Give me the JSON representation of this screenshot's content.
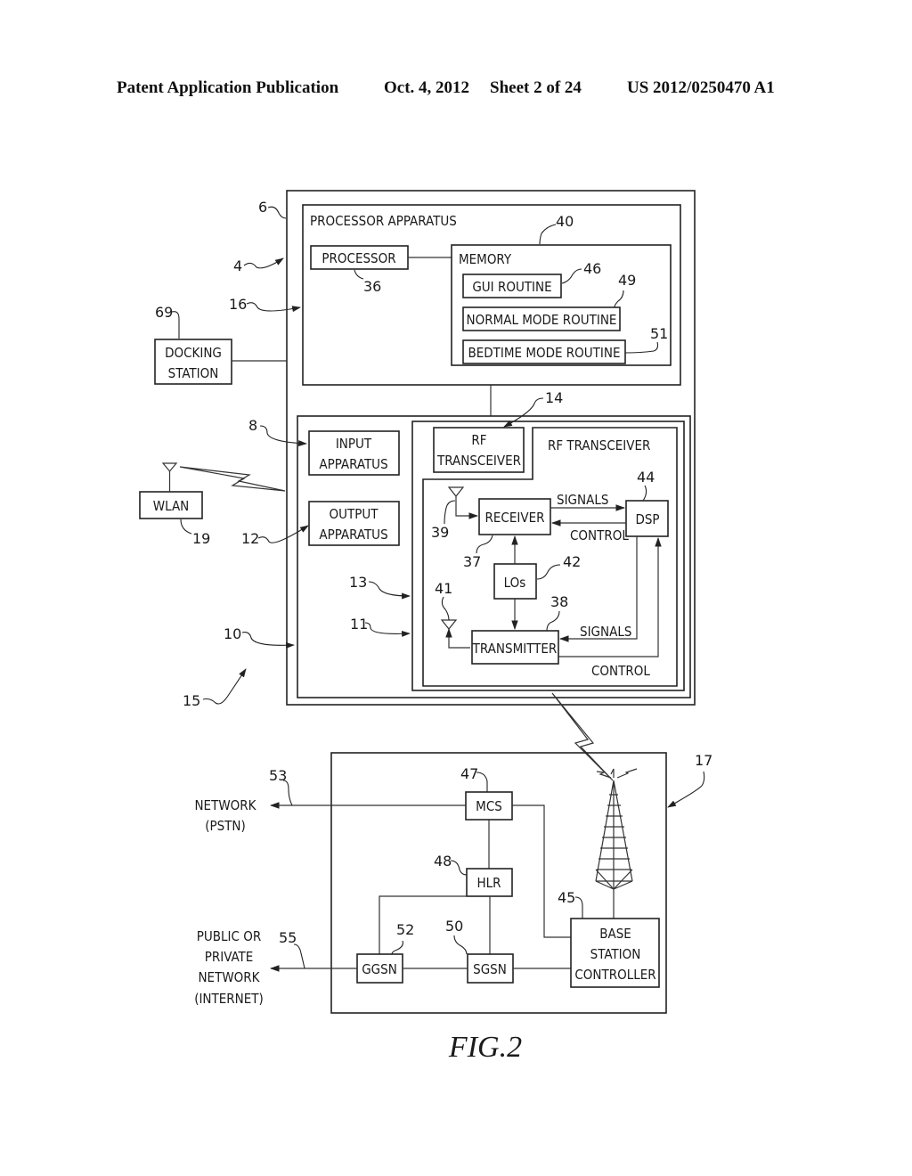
{
  "header": {
    "publication": "Patent Application Publication",
    "date": "Oct. 4, 2012",
    "sheet": "Sheet 2 of 24",
    "number": "US 2012/0250470 A1"
  },
  "figure": {
    "caption": "FIG.2",
    "device": {
      "ref_outer": "6",
      "ref_device": "4",
      "ref_system": "15",
      "processor_apparatus": {
        "title": "PROCESSOR APPARATUS",
        "ref": "16",
        "processor": {
          "label": "PROCESSOR",
          "ref": "36"
        },
        "memory": {
          "label": "MEMORY",
          "ref": "40",
          "routines": [
            {
              "label": "GUI ROUTINE",
              "ref": "46"
            },
            {
              "label": "NORMAL MODE ROUTINE",
              "ref": "49"
            },
            {
              "label": "BEDTIME MODE ROUTINE",
              "ref": "51"
            }
          ]
        }
      },
      "io_block_ref": "10",
      "input_apparatus": {
        "line1": "INPUT",
        "line2": "APPARATUS",
        "ref": "8"
      },
      "output_apparatus": {
        "line1": "OUTPUT",
        "line2": "APPARATUS",
        "ref": "12"
      },
      "rf": {
        "ref_outer": "13",
        "ref_inner": "11",
        "ref_tab": "14",
        "tab_line1": "RF",
        "tab_line2": "TRANSCEIVER",
        "title": "RF TRANSCEIVER",
        "receiver": {
          "label": "RECEIVER",
          "ref": "37"
        },
        "transmitter": {
          "label": "TRANSMITTER",
          "ref": "38"
        },
        "los": {
          "label": "LOs",
          "ref": "42"
        },
        "dsp": {
          "label": "DSP",
          "ref": "44"
        },
        "rx_antenna_ref": "39",
        "tx_antenna_ref": "41",
        "signals_label": "SIGNALS",
        "control_label": "CONTROL"
      }
    },
    "docking_station": {
      "line1": "DOCKING",
      "line2": "STATION",
      "ref": "69"
    },
    "wlan": {
      "label": "WLAN",
      "ref": "19"
    },
    "network": {
      "ref": "17",
      "mcs": {
        "label": "MCS",
        "ref": "47"
      },
      "hlr": {
        "label": "HLR",
        "ref": "48"
      },
      "sgsn": {
        "label": "SGSN",
        "ref": "50"
      },
      "ggsn": {
        "label": "GGSN",
        "ref": "52"
      },
      "bsc": {
        "line1": "BASE",
        "line2": "STATION",
        "line3": "CONTROLLER",
        "ref": "45"
      },
      "pstn": {
        "line1": "NETWORK",
        "line2": "(PSTN)",
        "ref": "53"
      },
      "internet": {
        "line1": "PUBLIC OR",
        "line2": "PRIVATE",
        "line3": "NETWORK",
        "line4": "(INTERNET)",
        "ref": "55"
      }
    }
  }
}
